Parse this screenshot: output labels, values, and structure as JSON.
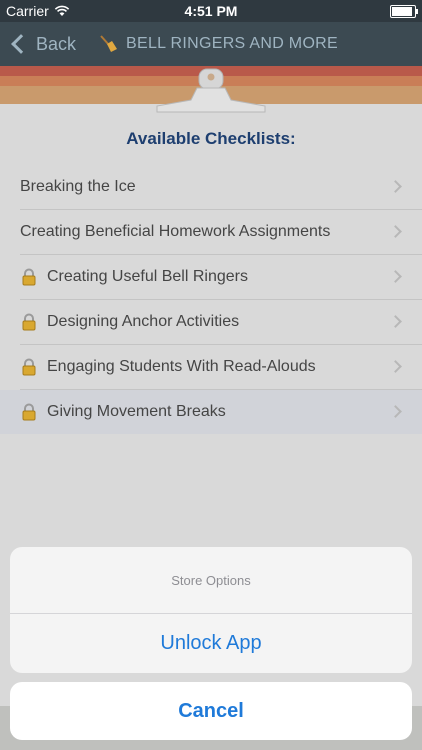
{
  "status_bar": {
    "carrier": "Carrier",
    "time": "4:51 PM",
    "battery_level": 1.0
  },
  "nav": {
    "back_label": "Back",
    "title": "BELL RINGERS AND MORE",
    "icon": "broom-icon"
  },
  "main": {
    "heading": "Available Checklists:",
    "items": [
      {
        "label": "Breaking the Ice",
        "locked": false
      },
      {
        "label": "Creating Beneficial Homework Assignments",
        "locked": false
      },
      {
        "label": "Creating Useful Bell Ringers",
        "locked": true
      },
      {
        "label": "Designing Anchor Activities",
        "locked": true
      },
      {
        "label": "Engaging Students With Read-Alouds",
        "locked": true
      },
      {
        "label": "Giving Movement Breaks",
        "locked": true
      }
    ]
  },
  "action_sheet": {
    "title": "Store Options",
    "unlock_label": "Unlock App",
    "cancel_label": "Cancel"
  },
  "colors": {
    "accent": "#1f7ad9",
    "heading": "#1e3f70",
    "nav_bg": "#3c4a52"
  }
}
